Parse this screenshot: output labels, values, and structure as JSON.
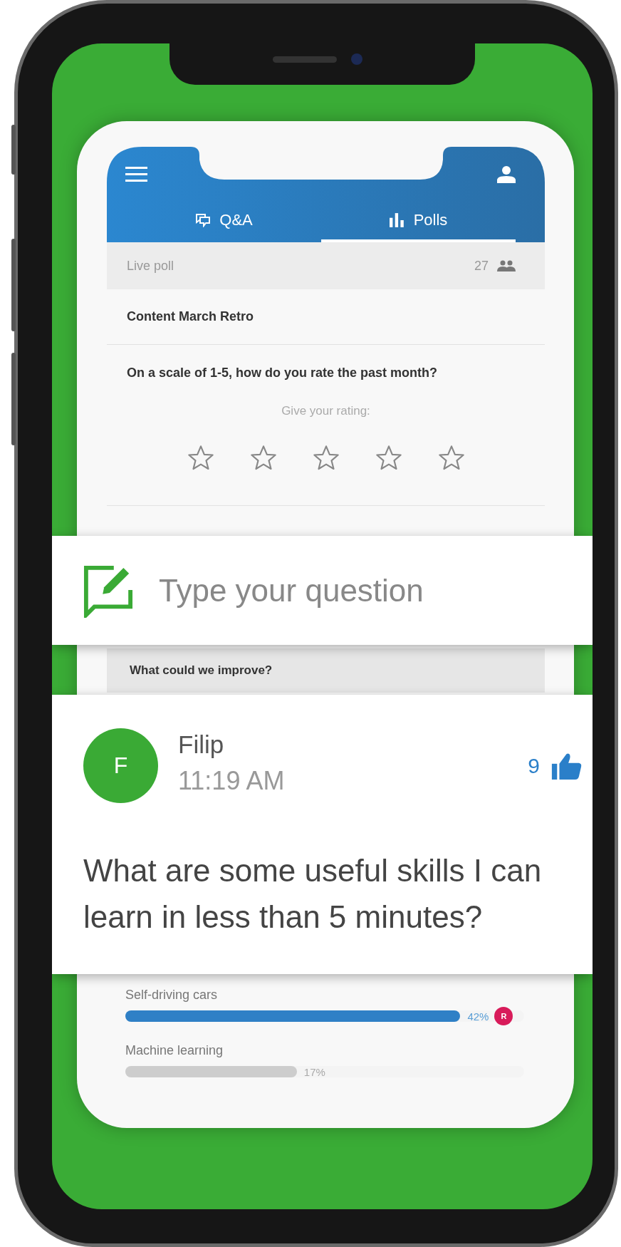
{
  "header": {
    "tabs": [
      {
        "label": "Q&A",
        "kind": "qa",
        "selected": false
      },
      {
        "label": "Polls",
        "kind": "polls",
        "selected": true
      }
    ]
  },
  "poll": {
    "status": "Live poll",
    "participants": "27",
    "title": "Content March Retro",
    "question": "On a scale of 1-5, how do you rate the past month?",
    "prompt": "Give your rating:",
    "stars": 0,
    "next_question": "What could we improve?",
    "options": [
      {
        "label": "Self-driving cars",
        "level": 0.84,
        "percent": "42%",
        "selected": true,
        "voter": "R"
      },
      {
        "label": "Machine learning",
        "level": 0.43,
        "percent": "17%",
        "selected": false
      }
    ]
  },
  "question_input": {
    "placeholder": "Type your question"
  },
  "question_card": {
    "avatar": "F",
    "name": "Filip",
    "time": "11:19 AM",
    "likes": "9",
    "text": "What are some useful skills I can learn in less than 5 minutes?"
  }
}
